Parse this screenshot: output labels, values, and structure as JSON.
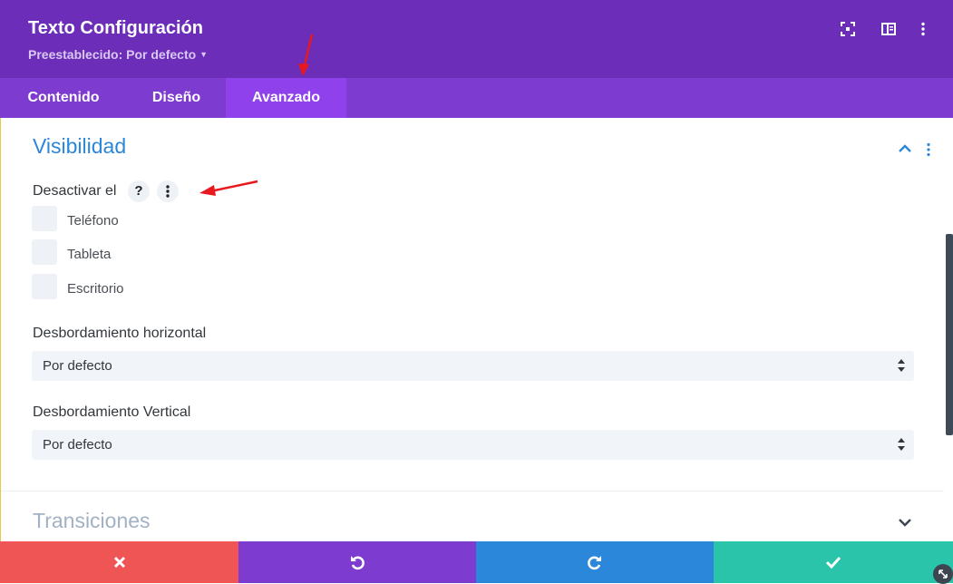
{
  "header": {
    "title": "Texto Configuración",
    "preset_label": "Preestablecido: Por defecto",
    "icons": [
      "focus-icon",
      "sidebar-toggle-icon",
      "more-vertical-icon"
    ]
  },
  "tabs": [
    {
      "label": "Contenido",
      "active": false
    },
    {
      "label": "Diseño",
      "active": false
    },
    {
      "label": "Avanzado",
      "active": true
    }
  ],
  "sections": {
    "visibilidad": {
      "title": "Visibilidad",
      "expanded": true,
      "disable_on": {
        "label": "Desactivar el",
        "help_icon": "?",
        "options": [
          {
            "label": "Teléfono",
            "checked": false
          },
          {
            "label": "Tableta",
            "checked": false
          },
          {
            "label": "Escritorio",
            "checked": false
          }
        ]
      },
      "overflow_x": {
        "label": "Desbordamiento horizontal",
        "value": "Por defecto"
      },
      "overflow_y": {
        "label": "Desbordamiento Vertical",
        "value": "Por defecto"
      }
    },
    "transiciones": {
      "title": "Transiciones",
      "expanded": false
    }
  },
  "footer": {
    "buttons": [
      {
        "name": "discard",
        "icon": "close-icon",
        "color": "#ef5555"
      },
      {
        "name": "undo",
        "icon": "undo-icon",
        "color": "#7d3bcf"
      },
      {
        "name": "redo",
        "icon": "redo-icon",
        "color": "#2b87da"
      },
      {
        "name": "save",
        "icon": "check-icon",
        "color": "#29c4a9"
      }
    ]
  },
  "colors": {
    "header_bg": "#6c2eb9",
    "tabs_bg": "#7e3bd0",
    "active_tab_bg": "#8f42ec",
    "section_title": "#2b87da",
    "annotation_arrow": "#e8191e"
  }
}
